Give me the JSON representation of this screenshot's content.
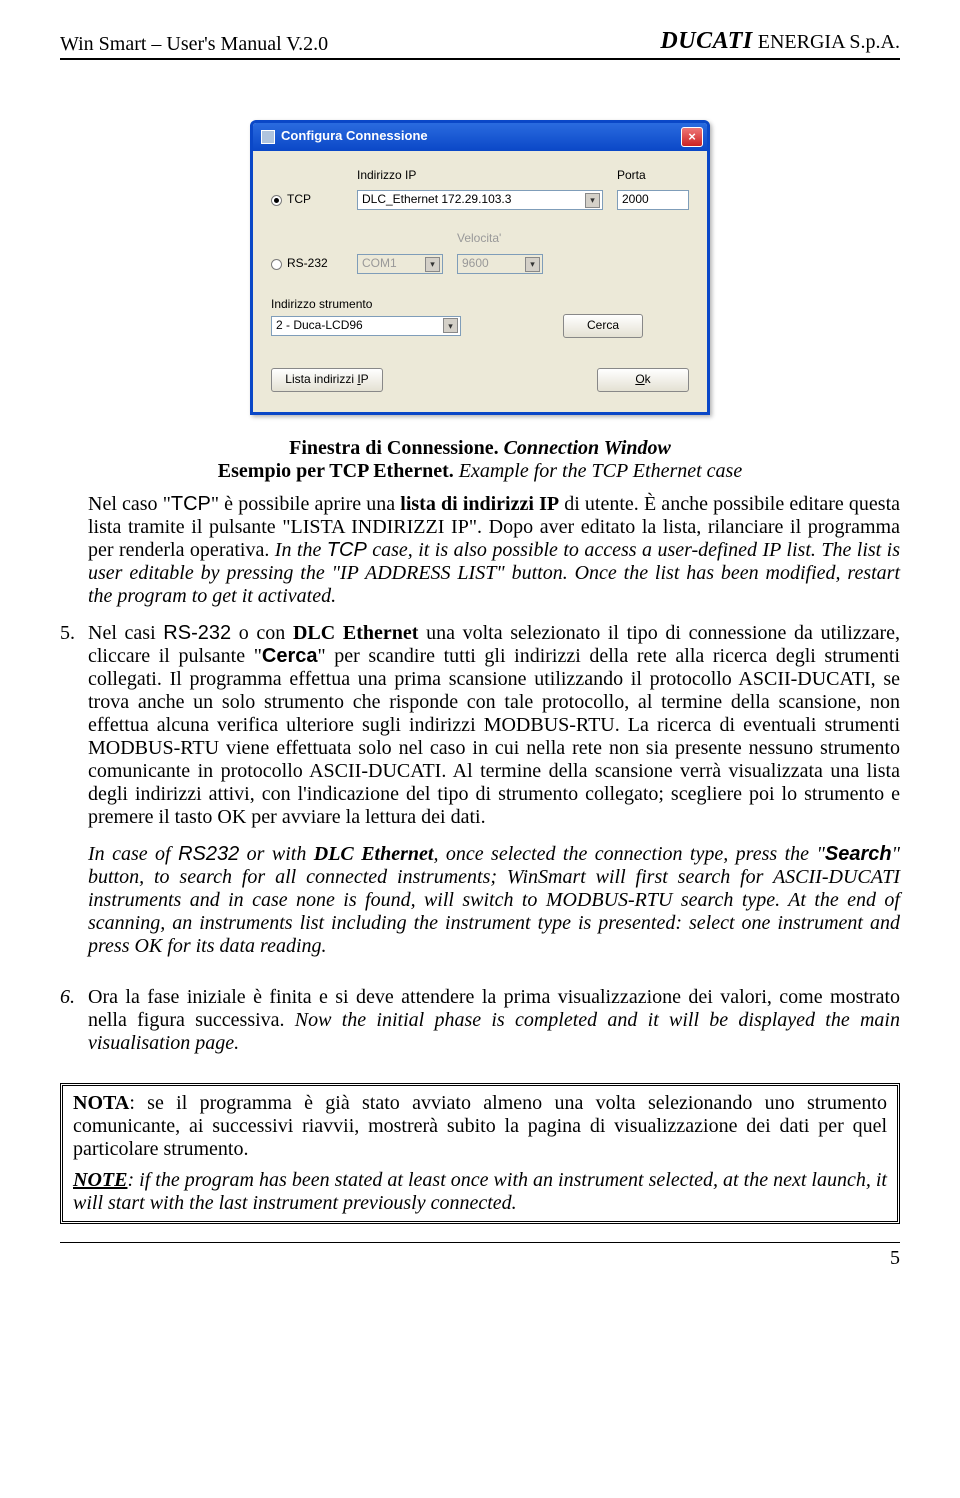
{
  "header": {
    "left": "Win Smart – User's Manual V.2.0",
    "right_bold": "DUCATI",
    "right_rest": " ENERGIA S.p.A."
  },
  "dialog": {
    "title": "Configura Connessione",
    "tcp": {
      "radio_label": "TCP",
      "ip_label": "Indirizzo IP",
      "ip_value": "DLC_Ethernet 172.29.103.3",
      "port_label": "Porta",
      "port_value": "2000"
    },
    "rs232": {
      "radio_label": "RS-232",
      "com_value": "COM1",
      "speed_label": "Velocita'",
      "speed_value": "9600"
    },
    "instr_label": "Indirizzo strumento",
    "instr_value": "2 - Duca-LCD96",
    "search_btn": "Cerca",
    "list_btn": "Lista indirizzi IP",
    "ok_btn": "Ok",
    "ok_u": "O",
    "ok_rest": "k"
  },
  "caption": {
    "line1a": "Finestra di Connessione.",
    "line1b": " Connection Window",
    "line2a": "Esempio per TCP Ethernet.",
    "line2b": " Example for the TCP Ethernet case"
  },
  "intro": {
    "p1": "Nel caso \"",
    "p2": "TCP",
    "p3": "\" è possibile aprire una ",
    "p4": "lista di indirizzi IP",
    "p5": " di utente. È anche possibile editare questa lista tramite il pulsante \"LISTA INDIRIZZI IP\". Dopo aver editato la lista, rilanciare il programma per renderla operativa. ",
    "p6": "In the ",
    "p7": "TCP",
    "p8": " case, it is also possible to access a user-defined IP list. The list is user editable by pressing the \"IP ADDRESS LIST\" button. Once the list has been modified, restart the program to get it activated."
  },
  "item5": {
    "n": "5.",
    "a": "Nel casi ",
    "b": "RS-232",
    "c": " o con ",
    "d": "DLC Ethernet",
    "e": " una volta selezionato il tipo di connessione da utilizzare, cliccare il pulsante \"",
    "f": "Cerca",
    "g": "\" per scandire tutti gli indirizzi della rete alla ricerca degli strumenti collegati. Il programma effettua una prima scansione utilizzando il protocollo ASCII-DUCATI, se trova anche un solo strumento che risponde con tale protocollo, al termine della scansione, non effettua alcuna verifica ulteriore sugli indirizzi MODBUS-RTU. La ricerca di eventuali strumenti MODBUS-RTU viene effettuata solo nel caso in cui nella rete non sia presente nessuno strumento comunicante in protocollo ASCII-DUCATI. Al termine della scansione verrà visualizzata una lista degli indirizzi attivi, con l'indicazione del tipo di strumento collegato; scegliere poi lo strumento e premere il tasto OK per avviare la lettura dei dati.",
    "h": "In case of ",
    "i": "RS232",
    "j": " or with ",
    "k": "DLC Ethernet",
    "l": ", once selected the connection type, press the \"",
    "m": "Search",
    "n2": "\" button, to search for all connected instruments; WinSmart will first search for ASCII-DUCATI instruments and in case none is found, will switch to MODBUS-RTU search type. At the end of scanning, an instruments list including the instrument type is presented: select one instrument and press OK for its data reading."
  },
  "item6": {
    "n": "6.",
    "a": "Ora la fase iniziale è finita e si deve attendere la prima visualizzazione dei valori, come mostrato nella figura successiva. ",
    "b": "Now the initial phase is completed and it will be displayed the main visualisation page."
  },
  "note": {
    "a1": "NOTA",
    "a2": ": se il programma è già stato avviato almeno una volta selezionando uno strumento comunicante, ai successivi riavvii, mostrerà subito la pagina di visualizzazione dei dati per quel particolare strumento.",
    "b1": "NOTE",
    "b2": ": if the program has been stated at least once with an instrument selected, at the next launch, it will start with the last instrument previously connected."
  },
  "page_number": "5"
}
